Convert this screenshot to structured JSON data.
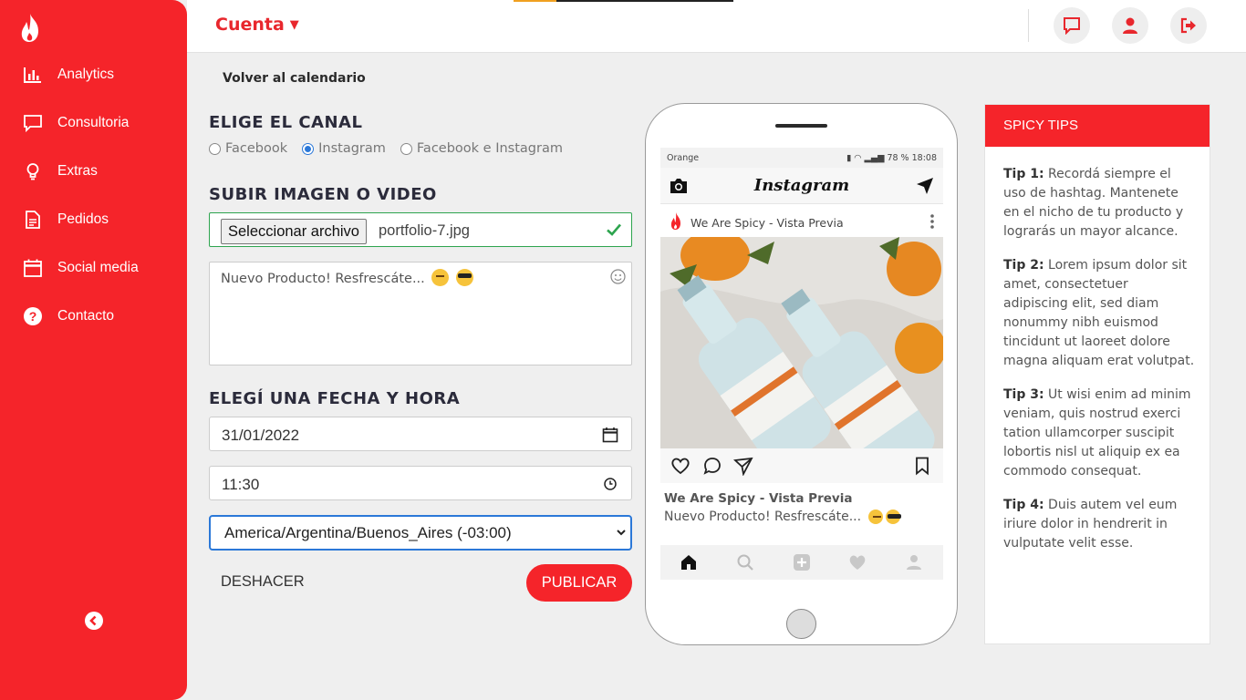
{
  "sidebar": {
    "items": [
      {
        "label": "Analytics",
        "icon": "bar-chart-icon"
      },
      {
        "label": "Consultoria",
        "icon": "chat-icon"
      },
      {
        "label": "Extras",
        "icon": "lightbulb-icon"
      },
      {
        "label": "Pedidos",
        "icon": "document-icon"
      },
      {
        "label": "Social media",
        "icon": "calendar-icon"
      },
      {
        "label": "Contacto",
        "icon": "question-icon"
      }
    ],
    "collapse_icon": "chevron-left-icon"
  },
  "header": {
    "account_label": "Cuenta",
    "buttons": [
      "messages-icon",
      "user-icon",
      "logout-icon"
    ]
  },
  "main": {
    "back_link": "Volver al calendario",
    "channel_title": "ELIGE EL CANAL",
    "channels": [
      {
        "label": "Facebook",
        "selected": false
      },
      {
        "label": "Instagram",
        "selected": true
      },
      {
        "label": "Facebook e Instagram",
        "selected": false
      }
    ],
    "upload_title": "SUBIR IMAGEN O VIDEO",
    "file_button": "Seleccionar archivo",
    "file_name": "portfolio-7.jpg",
    "caption": "Nuevo Producto! Resfrescáte...",
    "datetime_title": "ELEGÍ UNA FECHA Y HORA",
    "date": "31/01/2022",
    "time": "11:30",
    "timezone": "America/Argentina/Buenos_Aires (-03:00)",
    "undo": "DESHACER",
    "publish": "PUBLICAR"
  },
  "preview": {
    "carrier": "Orange",
    "status_right": "78 %  18:08",
    "app_name": "Instagram",
    "username": "We Are Spicy - Vista Previa",
    "caption": "Nuevo Producto! Resfrescáte..."
  },
  "tips": {
    "title": "SPICY TIPS",
    "items": [
      {
        "label": "Tip 1:",
        "text": "Recordá siempre el uso de hashtag. Mantenete en el nicho de tu producto y lograrás un mayor alcance."
      },
      {
        "label": "Tip 2:",
        "text": "Lorem ipsum dolor sit amet, consectetuer adipiscing elit, sed diam nonummy nibh euismod tincidunt ut laoreet dolore magna aliquam erat volutpat."
      },
      {
        "label": "Tip 3:",
        "text": "Ut wisi enim ad minim veniam, quis nostrud exerci tation ullamcorper suscipit lobortis nisl ut aliquip ex ea commodo consequat."
      },
      {
        "label": "Tip 4:",
        "text": "Duis autem vel eum iriure dolor in hendrerit in vulputate velit esse."
      }
    ]
  },
  "colors": {
    "brand": "#f5242a",
    "focus": "#2b78d8",
    "success": "#2da44e"
  }
}
